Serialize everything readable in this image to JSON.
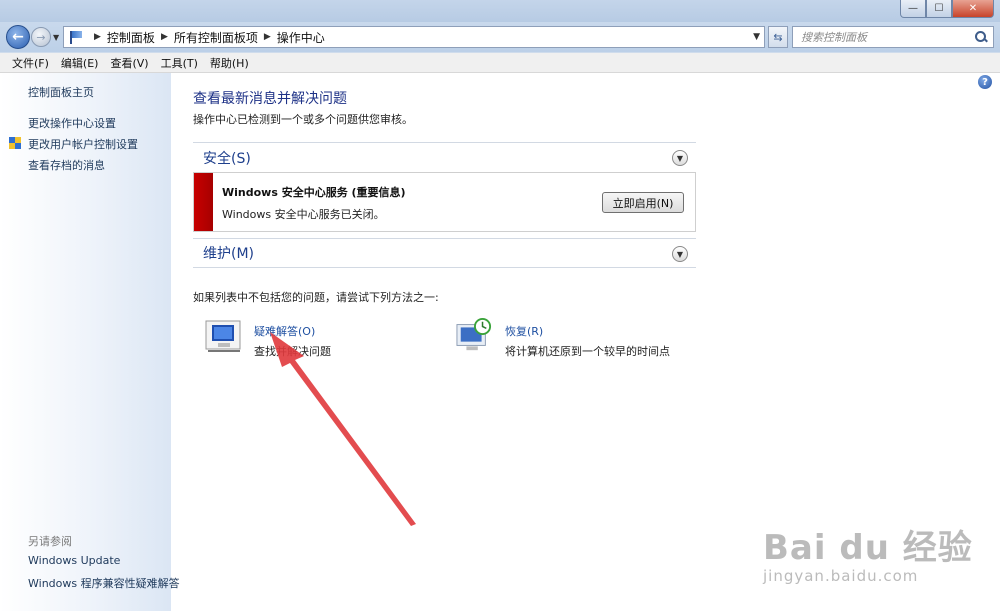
{
  "window": {
    "caption": {
      "minimize": "—",
      "maximize": "☐",
      "close": "✕"
    }
  },
  "nav": {
    "back": "←",
    "forward": "→",
    "breadcrumbs": [
      "控制面板",
      "所有控制面板项",
      "操作中心"
    ],
    "search_placeholder": "搜索控制面板"
  },
  "menu": [
    "文件(F)",
    "编辑(E)",
    "查看(V)",
    "工具(T)",
    "帮助(H)"
  ],
  "sidebar": {
    "links": [
      "控制面板主页",
      "更改操作中心设置",
      "更改用户帐户控制设置",
      "查看存档的消息"
    ],
    "see_also_title": "另请参阅",
    "see_also": [
      "Windows Update",
      "Windows 程序兼容性疑难解答"
    ]
  },
  "main": {
    "title": "查看最新消息并解决问题",
    "subtitle": "操作中心已检测到一个或多个问题供您审核。",
    "security": {
      "label": "安全(S)",
      "alert_title": "Windows 安全中心服务 (重要信息)",
      "alert_desc": "Windows 安全中心服务已关闭。",
      "button": "立即启用(N)"
    },
    "maintenance": {
      "label": "维护(M)"
    },
    "hint": "如果列表中不包括您的问题，请尝试下列方法之一:",
    "troubleshoot": {
      "link": "疑难解答(O)",
      "desc": "查找并解决问题"
    },
    "recovery": {
      "link": "恢复(R)",
      "desc": "将计算机还原到一个较早的时间点"
    }
  },
  "watermark": {
    "main": "Bai du 经验",
    "sub": "jingyan.baidu.com"
  },
  "colors": {
    "alert_red": "#c80000",
    "link_blue": "#1e4fa1",
    "title_blue": "#1e3287",
    "annotation_arrow": "#e0393c"
  }
}
